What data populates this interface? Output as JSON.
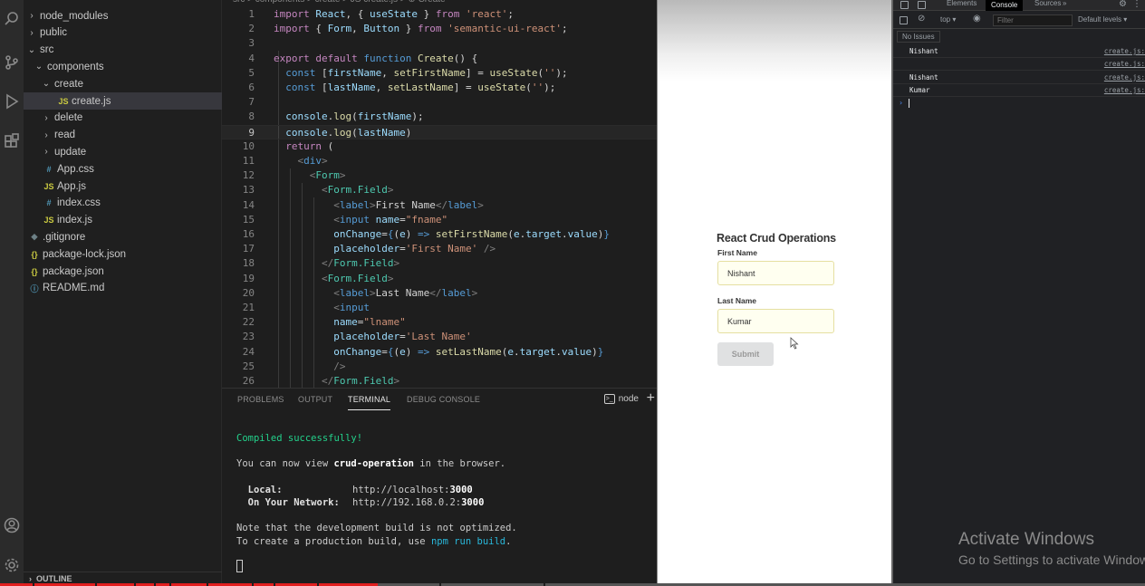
{
  "activity_bar": {
    "icons": [
      "search-icon",
      "source-control-icon",
      "run-debug-icon",
      "extensions-icon",
      "account-icon",
      "settings-gear-icon"
    ]
  },
  "explorer": {
    "items": [
      {
        "label": "node_modules",
        "type": "folder",
        "expanded": false,
        "depth": 1
      },
      {
        "label": "public",
        "type": "folder",
        "expanded": false,
        "depth": 1
      },
      {
        "label": "src",
        "type": "folder",
        "expanded": true,
        "depth": 1
      },
      {
        "label": "components",
        "type": "folder",
        "expanded": true,
        "depth": 2
      },
      {
        "label": "create",
        "type": "folder",
        "expanded": true,
        "depth": 3
      },
      {
        "label": "create.js",
        "type": "js",
        "depth": 4,
        "selected": true
      },
      {
        "label": "delete",
        "type": "folder",
        "expanded": false,
        "depth": 3
      },
      {
        "label": "read",
        "type": "folder",
        "expanded": false,
        "depth": 3
      },
      {
        "label": "update",
        "type": "folder",
        "expanded": false,
        "depth": 3
      },
      {
        "label": "App.css",
        "type": "css",
        "depth": 2
      },
      {
        "label": "App.js",
        "type": "js",
        "depth": 2
      },
      {
        "label": "index.css",
        "type": "css",
        "depth": 2
      },
      {
        "label": "index.js",
        "type": "js",
        "depth": 2
      },
      {
        "label": ".gitignore",
        "type": "git",
        "depth": 1
      },
      {
        "label": "package-lock.json",
        "type": "json",
        "depth": 1
      },
      {
        "label": "package.json",
        "type": "json",
        "depth": 1
      },
      {
        "label": "README.md",
        "type": "md",
        "depth": 1
      }
    ],
    "outline_label": "OUTLINE"
  },
  "editor": {
    "breadcrumb": "src > components > create > JS create.js > ⊕ Create",
    "active_line": 9,
    "lines": [
      {
        "n": "1",
        "tokens": [
          [
            "kw",
            "import"
          ],
          [
            "txt",
            " "
          ],
          [
            "var",
            "React"
          ],
          [
            "txt",
            ", { "
          ],
          [
            "var",
            "useState"
          ],
          [
            "txt",
            " } "
          ],
          [
            "kw",
            "from"
          ],
          [
            "txt",
            " "
          ],
          [
            "str",
            "'react'"
          ],
          [
            "txt",
            ";"
          ]
        ]
      },
      {
        "n": "2",
        "tokens": [
          [
            "kw",
            "import"
          ],
          [
            "txt",
            " { "
          ],
          [
            "var",
            "Form"
          ],
          [
            "txt",
            ", "
          ],
          [
            "var",
            "Button"
          ],
          [
            "txt",
            " } "
          ],
          [
            "kw",
            "from"
          ],
          [
            "txt",
            " "
          ],
          [
            "str",
            "'semantic-ui-react'"
          ],
          [
            "txt",
            ";"
          ]
        ]
      },
      {
        "n": "3",
        "tokens": []
      },
      {
        "n": "4",
        "tokens": [
          [
            "kw",
            "export"
          ],
          [
            "txt",
            " "
          ],
          [
            "kw",
            "default"
          ],
          [
            "txt",
            " "
          ],
          [
            "kw2",
            "function"
          ],
          [
            "txt",
            " "
          ],
          [
            "fn",
            "Create"
          ],
          [
            "txt",
            "() {"
          ]
        ]
      },
      {
        "n": "5",
        "tokens": [
          [
            "txt",
            "  "
          ],
          [
            "kw2",
            "const"
          ],
          [
            "txt",
            " ["
          ],
          [
            "var",
            "firstName"
          ],
          [
            "txt",
            ", "
          ],
          [
            "fn",
            "setFirstName"
          ],
          [
            "txt",
            "] = "
          ],
          [
            "fn",
            "useState"
          ],
          [
            "txt",
            "("
          ],
          [
            "str",
            "''"
          ],
          [
            "txt",
            ");"
          ]
        ]
      },
      {
        "n": "6",
        "tokens": [
          [
            "txt",
            "  "
          ],
          [
            "kw2",
            "const"
          ],
          [
            "txt",
            " ["
          ],
          [
            "var",
            "lastName"
          ],
          [
            "txt",
            ", "
          ],
          [
            "fn",
            "setLastName"
          ],
          [
            "txt",
            "] = "
          ],
          [
            "fn",
            "useState"
          ],
          [
            "txt",
            "("
          ],
          [
            "str",
            "''"
          ],
          [
            "txt",
            ");"
          ]
        ]
      },
      {
        "n": "7",
        "tokens": []
      },
      {
        "n": "8",
        "tokens": [
          [
            "txt",
            "  "
          ],
          [
            "var",
            "console"
          ],
          [
            "txt",
            "."
          ],
          [
            "fn",
            "log"
          ],
          [
            "txt",
            "("
          ],
          [
            "var",
            "firstName"
          ],
          [
            "txt",
            ");"
          ]
        ]
      },
      {
        "n": "9",
        "tokens": [
          [
            "txt",
            "  "
          ],
          [
            "var",
            "console"
          ],
          [
            "txt",
            "."
          ],
          [
            "fn",
            "log"
          ],
          [
            "txt",
            "("
          ],
          [
            "var",
            "lastName"
          ],
          [
            "txt",
            ")"
          ]
        ]
      },
      {
        "n": "10",
        "tokens": [
          [
            "txt",
            "  "
          ],
          [
            "kw",
            "return"
          ],
          [
            "txt",
            " ("
          ]
        ]
      },
      {
        "n": "11",
        "tokens": [
          [
            "txt",
            "    "
          ],
          [
            "pun",
            "<"
          ],
          [
            "tagb",
            "div"
          ],
          [
            "pun",
            ">"
          ]
        ]
      },
      {
        "n": "12",
        "tokens": [
          [
            "txt",
            "      "
          ],
          [
            "pun",
            "<"
          ],
          [
            "tag",
            "Form"
          ],
          [
            "pun",
            ">"
          ]
        ]
      },
      {
        "n": "13",
        "tokens": [
          [
            "txt",
            "        "
          ],
          [
            "pun",
            "<"
          ],
          [
            "tag",
            "Form.Field"
          ],
          [
            "pun",
            ">"
          ]
        ]
      },
      {
        "n": "14",
        "tokens": [
          [
            "txt",
            "          "
          ],
          [
            "pun",
            "<"
          ],
          [
            "tagb",
            "label"
          ],
          [
            "pun",
            ">"
          ],
          [
            "txt",
            "First Name"
          ],
          [
            "pun",
            "</"
          ],
          [
            "tagb",
            "label"
          ],
          [
            "pun",
            ">"
          ]
        ]
      },
      {
        "n": "15",
        "tokens": [
          [
            "txt",
            "          "
          ],
          [
            "pun",
            "<"
          ],
          [
            "tagb",
            "input"
          ],
          [
            "txt",
            " "
          ],
          [
            "var",
            "name"
          ],
          [
            "txt",
            "="
          ],
          [
            "str",
            "\"fname\""
          ]
        ]
      },
      {
        "n": "16",
        "tokens": [
          [
            "txt",
            "          "
          ],
          [
            "var",
            "onChange"
          ],
          [
            "txt",
            "="
          ],
          [
            "kw2",
            "{"
          ],
          [
            "txt",
            "("
          ],
          [
            "var",
            "e"
          ],
          [
            "txt",
            ") "
          ],
          [
            "kw2",
            "=>"
          ],
          [
            "txt",
            " "
          ],
          [
            "fn",
            "setFirstName"
          ],
          [
            "txt",
            "("
          ],
          [
            "var",
            "e"
          ],
          [
            "txt",
            "."
          ],
          [
            "var",
            "target"
          ],
          [
            "txt",
            "."
          ],
          [
            "var",
            "value"
          ],
          [
            "txt",
            ")"
          ],
          [
            "kw2",
            "}"
          ]
        ]
      },
      {
        "n": "17",
        "tokens": [
          [
            "txt",
            "          "
          ],
          [
            "var",
            "placeholder"
          ],
          [
            "txt",
            "="
          ],
          [
            "str",
            "'First Name'"
          ],
          [
            "txt",
            " "
          ],
          [
            "pun",
            "/>"
          ]
        ]
      },
      {
        "n": "18",
        "tokens": [
          [
            "txt",
            "        "
          ],
          [
            "pun",
            "</"
          ],
          [
            "tag",
            "Form.Field"
          ],
          [
            "pun",
            ">"
          ]
        ]
      },
      {
        "n": "19",
        "tokens": [
          [
            "txt",
            "        "
          ],
          [
            "pun",
            "<"
          ],
          [
            "tag",
            "Form.Field"
          ],
          [
            "pun",
            ">"
          ]
        ]
      },
      {
        "n": "20",
        "tokens": [
          [
            "txt",
            "          "
          ],
          [
            "pun",
            "<"
          ],
          [
            "tagb",
            "label"
          ],
          [
            "pun",
            ">"
          ],
          [
            "txt",
            "Last Name"
          ],
          [
            "pun",
            "</"
          ],
          [
            "tagb",
            "label"
          ],
          [
            "pun",
            ">"
          ]
        ]
      },
      {
        "n": "21",
        "tokens": [
          [
            "txt",
            "          "
          ],
          [
            "pun",
            "<"
          ],
          [
            "tagb",
            "input"
          ]
        ]
      },
      {
        "n": "22",
        "tokens": [
          [
            "txt",
            "          "
          ],
          [
            "var",
            "name"
          ],
          [
            "txt",
            "="
          ],
          [
            "str",
            "\"lname\""
          ]
        ]
      },
      {
        "n": "23",
        "tokens": [
          [
            "txt",
            "          "
          ],
          [
            "var",
            "placeholder"
          ],
          [
            "txt",
            "="
          ],
          [
            "str",
            "'Last Name'"
          ]
        ]
      },
      {
        "n": "24",
        "tokens": [
          [
            "txt",
            "          "
          ],
          [
            "var",
            "onChange"
          ],
          [
            "txt",
            "="
          ],
          [
            "kw2",
            "{"
          ],
          [
            "txt",
            "("
          ],
          [
            "var",
            "e"
          ],
          [
            "txt",
            ") "
          ],
          [
            "kw2",
            "=>"
          ],
          [
            "txt",
            " "
          ],
          [
            "fn",
            "setLastName"
          ],
          [
            "txt",
            "("
          ],
          [
            "var",
            "e"
          ],
          [
            "txt",
            "."
          ],
          [
            "var",
            "target"
          ],
          [
            "txt",
            "."
          ],
          [
            "var",
            "value"
          ],
          [
            "txt",
            ")"
          ],
          [
            "kw2",
            "}"
          ]
        ]
      },
      {
        "n": "25",
        "tokens": [
          [
            "txt",
            "          "
          ],
          [
            "pun",
            "/>"
          ]
        ]
      },
      {
        "n": "26",
        "tokens": [
          [
            "txt",
            "        "
          ],
          [
            "pun",
            "</"
          ],
          [
            "tag",
            "Form.Field"
          ],
          [
            "pun",
            ">"
          ]
        ]
      }
    ]
  },
  "panel": {
    "tabs": [
      "PROBLEMS",
      "OUTPUT",
      "TERMINAL",
      "DEBUG CONSOLE"
    ],
    "active_tab": "TERMINAL",
    "terminal_name": "node",
    "terminal": {
      "compiled": "Compiled successfully!",
      "view_prefix": "You can now view ",
      "app_name": "crud-operation",
      "view_suffix": " in the browser.",
      "local_label": "  Local:",
      "local_url_prefix": "http://localhost:",
      "local_port": "3000",
      "network_label": "  On Your Network:",
      "network_url_prefix": "http://192.168.0.2:",
      "network_port": "3000",
      "note1": "Note that the development build is not optimized.",
      "note2_prefix": "To create a production build, use ",
      "note2_cmd": "npm run build",
      "note2_suffix": "."
    }
  },
  "browser": {
    "title": "React Crud Operations",
    "first_name_label": "First Name",
    "first_name_value": "Nishant",
    "first_name_placeholder": "First Name",
    "last_name_label": "Last Name",
    "last_name_value": "Kumar",
    "last_name_placeholder": "Last Name",
    "submit_label": "Submit"
  },
  "devtools": {
    "tabs": [
      "Elements",
      "Console",
      "Sources"
    ],
    "active_tab": "Console",
    "context": "top ▾",
    "filter_placeholder": "Filter",
    "levels": "Default levels ▾",
    "issues": "No Issues",
    "console_rows": [
      {
        "msg": "Nishant",
        "src": "create.js:"
      },
      {
        "msg": "",
        "src": "create.js:"
      },
      {
        "msg": "Nishant",
        "src": "create.js:"
      },
      {
        "msg": "Kumar",
        "src": "create.js:"
      }
    ],
    "prompt": "›"
  },
  "watermark": {
    "line1": "Activate Windows",
    "line2": "Go to Settings to activate Windows."
  },
  "video_progress": 0.33,
  "colors": {
    "editor_bg": "#1e1e1e",
    "sidebar_bg": "#1f1f1f",
    "terminal_green": "#23d18b",
    "devtools_bg": "#202124",
    "input_bg": "#fffff0",
    "progress_red": "#e21f1f"
  }
}
